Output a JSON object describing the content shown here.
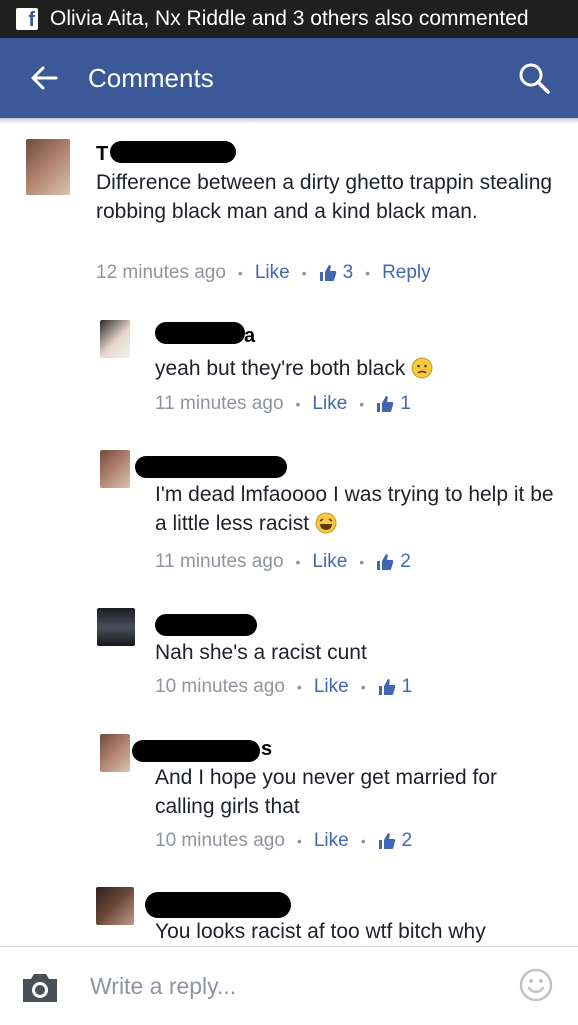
{
  "notification": {
    "text": "Olivia Aita, Nx Riddle and 3 others also commented"
  },
  "header": {
    "title": "Comments"
  },
  "comments": [
    {
      "name_fragment": "T",
      "text": "Difference between a dirty ghetto trappin stealing robbing black man and a kind black man.",
      "time": "12 minutes ago",
      "like_label": "Like",
      "likes": "3",
      "reply_label": "Reply"
    },
    {
      "name_fragment": "a",
      "text": "yeah but they're both black",
      "time": "11 minutes ago",
      "like_label": "Like",
      "likes": "1"
    },
    {
      "text": "I'm dead lmfaoooo I was trying to help it be a little less racist",
      "time": "11 minutes ago",
      "like_label": "Like",
      "likes": "2"
    },
    {
      "text": "Nah she's a racist cunt",
      "time": "10 minutes ago",
      "like_label": "Like",
      "likes": "1"
    },
    {
      "name_fragment": "s",
      "text": "And I hope you never get married for calling girls that",
      "time": "10 minutes ago",
      "like_label": "Like",
      "likes": "2"
    },
    {
      "text": "You looks racist af too wtf bitch why"
    }
  ],
  "reply_input": {
    "placeholder": "Write a reply..."
  },
  "icons": {
    "notification": "facebook-logo-icon",
    "back": "back-arrow-icon",
    "search": "search-icon",
    "like": "thumbs-up-icon",
    "camera": "camera-icon",
    "sticker": "smiley-icon"
  },
  "colors": {
    "header": "#3b5998",
    "link": "#4267b2",
    "meta": "#90949c"
  }
}
